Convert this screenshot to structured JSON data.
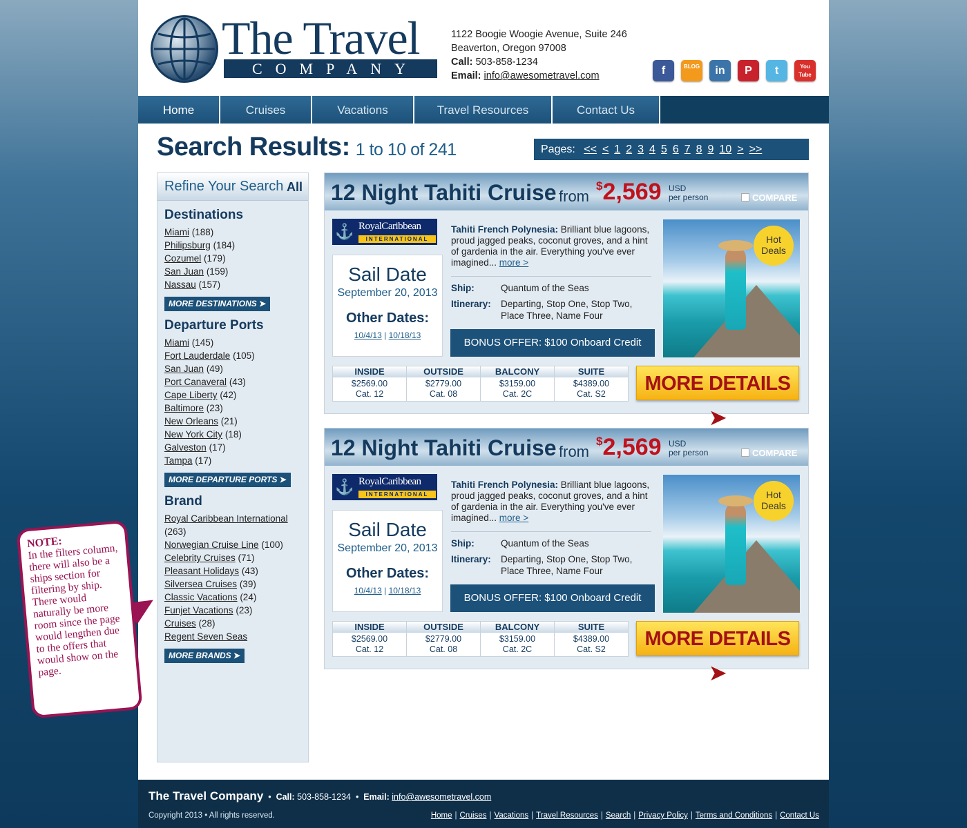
{
  "header": {
    "logo_title": "The Travel",
    "logo_subtitle": "COMPANY",
    "address_line1": "1122 Boogie Woogie Avenue, Suite 246",
    "address_line2": "Beaverton, Oregon  97008",
    "call_label": "Call:",
    "phone": "503-858-1234",
    "email_label": "Email:",
    "email": "info@awesometravel.com",
    "social": [
      {
        "name": "facebook-icon",
        "glyph": "f",
        "color": "#3b5998"
      },
      {
        "name": "blog-icon",
        "glyph": "BLOG",
        "color": "#f39a1d"
      },
      {
        "name": "linkedin-icon",
        "glyph": "in",
        "color": "#3b74a8"
      },
      {
        "name": "pinterest-icon",
        "glyph": "P",
        "color": "#c8232c"
      },
      {
        "name": "twitter-icon",
        "glyph": "t",
        "color": "#55b6e4"
      },
      {
        "name": "youtube-icon",
        "glyph": "You Tube",
        "color": "#d9302b"
      }
    ]
  },
  "nav": [
    "Home",
    "Cruises",
    "Vacations",
    "Travel Resources",
    "Contact Us"
  ],
  "search": {
    "title": "Search Results:",
    "range": "1 to 10 of 241",
    "pages_label": "Pages:",
    "pages": [
      "<<",
      "<",
      "1",
      "2",
      "3",
      "4",
      "5",
      "6",
      "7",
      "8",
      "9",
      "10",
      ">",
      ">>"
    ]
  },
  "sidebar": {
    "title": "Refine Your Search",
    "all_label": "All",
    "sections": [
      {
        "heading": "Destinations",
        "items": [
          [
            "Miami",
            "(188)"
          ],
          [
            "Philipsburg",
            "(184)"
          ],
          [
            "Cozumel",
            "(179)"
          ],
          [
            "San Juan",
            "(159)"
          ],
          [
            "Nassau",
            "(157)"
          ]
        ],
        "more": "MORE DESTINATIONS"
      },
      {
        "heading": "Departure Ports",
        "items": [
          [
            "Miami",
            "(145)"
          ],
          [
            "Fort Lauderdale",
            "(105)"
          ],
          [
            "San Juan",
            "(49)"
          ],
          [
            "Port Canaveral",
            "(43)"
          ],
          [
            "Cape Liberty",
            "(42)"
          ],
          [
            "Baltimore",
            "(23)"
          ],
          [
            "New Orleans",
            "(21)"
          ],
          [
            "New York City",
            "(18)"
          ],
          [
            "Galveston",
            "(17)"
          ],
          [
            "Tampa",
            "(17)"
          ]
        ],
        "more": "MORE DEPARTURE PORTS"
      },
      {
        "heading": "Brand",
        "items": [
          [
            "Royal Caribbean International",
            "(263)"
          ],
          [
            "Norwegian Cruise Line",
            "(100)"
          ],
          [
            "Celebrity Cruises",
            "(71)"
          ],
          [
            "Pleasant Holidays",
            "(43)"
          ],
          [
            "Silversea Cruises",
            "(39)"
          ],
          [
            "Classic Vacations",
            "(24)"
          ],
          [
            "Funjet Vacations",
            "(23)"
          ],
          [
            "Cruises",
            "(28)"
          ],
          [
            "Regent Seven Seas",
            ""
          ]
        ],
        "more": "MORE BRANDS"
      }
    ]
  },
  "results": [
    {
      "title": "12 Night Tahiti Cruise",
      "from": "from",
      "currency_symbol": "$",
      "price": "2,569",
      "usd": "USD",
      "per_person": "per person",
      "compare": "COMPARE",
      "brand_name": "RoyalCaribbean",
      "brand_sub": "INTERNATIONAL",
      "sail_label": "Sail Date",
      "sail_date": "September 20, 2013",
      "other_label": "Other Dates:",
      "other_dates": [
        "10/4/13",
        "10/18/13"
      ],
      "desc_title": "Tahiti French Polynesia:",
      "desc_text": " Brilliant blue lagoons, proud jagged peaks, coconut groves, and a hint of gardenia in the air. Everything you've ever imagined... ",
      "more_link": "more >",
      "ship_label": "Ship:",
      "ship": "Quantum of the Seas",
      "itinerary_label": "Itinerary:",
      "itinerary": "Departing, Stop One, Stop Two, Place Three, Name Four",
      "bonus": "BONUS OFFER: $100 Onboard Credit",
      "hot_deals": "Hot Deals",
      "rates": [
        {
          "type": "INSIDE",
          "price": "$2569.00",
          "cat": "Cat. 12"
        },
        {
          "type": "OUTSIDE",
          "price": "$2779.00",
          "cat": "Cat. 08"
        },
        {
          "type": "BALCONY",
          "price": "$3159.00",
          "cat": "Cat. 2C"
        },
        {
          "type": "SUITE",
          "price": "$4389.00",
          "cat": "Cat. S2"
        }
      ],
      "more_details": "MORE DETAILS"
    },
    {
      "title": "12 Night Tahiti Cruise",
      "from": "from",
      "currency_symbol": "$",
      "price": "2,569",
      "usd": "USD",
      "per_person": "per person",
      "compare": "COMPARE",
      "brand_name": "RoyalCaribbean",
      "brand_sub": "INTERNATIONAL",
      "sail_label": "Sail Date",
      "sail_date": "September 20, 2013",
      "other_label": "Other Dates:",
      "other_dates": [
        "10/4/13",
        "10/18/13"
      ],
      "desc_title": "Tahiti French Polynesia:",
      "desc_text": " Brilliant blue lagoons, proud jagged peaks, coconut groves, and a hint of gardenia in the air. Everything you've ever imagined... ",
      "more_link": "more >",
      "ship_label": "Ship:",
      "ship": "Quantum of the Seas",
      "itinerary_label": "Itinerary:",
      "itinerary": "Departing, Stop One, Stop Two, Place Three, Name Four",
      "bonus": "BONUS OFFER: $100 Onboard Credit",
      "hot_deals": "Hot Deals",
      "rates": [
        {
          "type": "INSIDE",
          "price": "$2569.00",
          "cat": "Cat. 12"
        },
        {
          "type": "OUTSIDE",
          "price": "$2779.00",
          "cat": "Cat. 08"
        },
        {
          "type": "BALCONY",
          "price": "$3159.00",
          "cat": "Cat. 2C"
        },
        {
          "type": "SUITE",
          "price": "$4389.00",
          "cat": "Cat. S2"
        }
      ],
      "more_details": "MORE DETAILS"
    }
  ],
  "footer": {
    "brand": "The Travel Company",
    "call_label": "Call:",
    "phone": "503-858-1234",
    "email_label": "Email:",
    "email": "info@awesometravel.com",
    "copyright": "Copyright 2013  •  All rights reserved.",
    "links": [
      "Home",
      "Cruises",
      "Vacations",
      "Travel Resources",
      "Search",
      "Privacy Policy",
      "Terms and Conditions",
      "Contact Us"
    ]
  },
  "note": {
    "label": "NOTE:",
    "text": "In the filters column, there will also be a ships section for filtering by ship. There would naturally be more room since the page would lengthen due to the offers that would show on the page."
  }
}
